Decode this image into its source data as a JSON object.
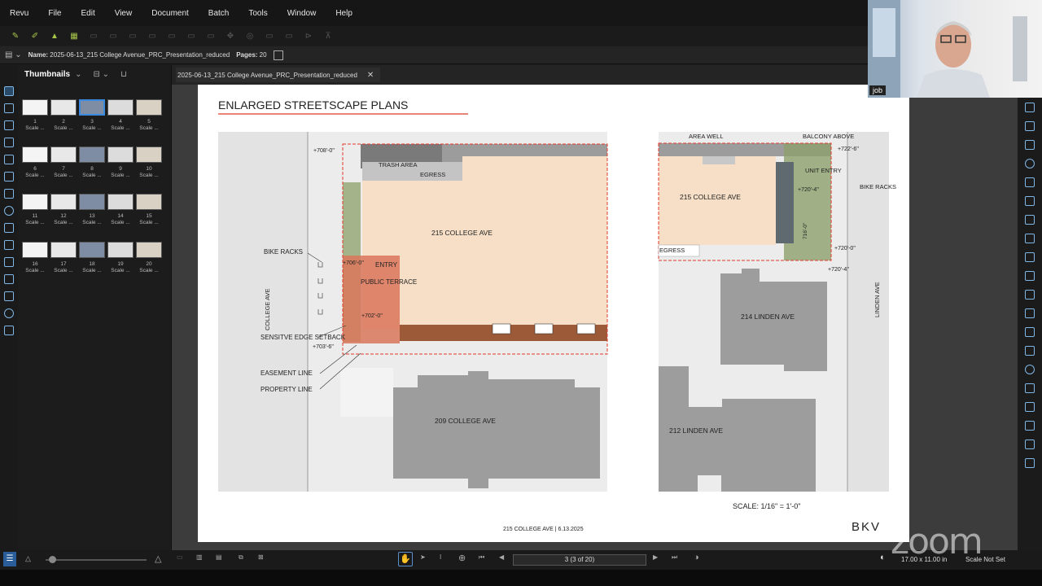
{
  "menu": [
    "Revu",
    "File",
    "Edit",
    "View",
    "Document",
    "Batch",
    "Tools",
    "Window",
    "Help"
  ],
  "file_info": {
    "name_label": "Name:",
    "name_value": "2025-06-13_215 College Avenue_PRC_Presentation_reduced",
    "pages_label": "Pages:",
    "pages_value": "20"
  },
  "thumbnails": {
    "title": "Thumbnails",
    "items": [
      {
        "num": "1",
        "label": "Scale ..."
      },
      {
        "num": "2",
        "label": "Scale ..."
      },
      {
        "num": "3",
        "label": "Scale ..."
      },
      {
        "num": "4",
        "label": "Scale ..."
      },
      {
        "num": "5",
        "label": "Scale ..."
      },
      {
        "num": "6",
        "label": "Scale ..."
      },
      {
        "num": "7",
        "label": "Scale ..."
      },
      {
        "num": "8",
        "label": "Scale ..."
      },
      {
        "num": "9",
        "label": "Scale ..."
      },
      {
        "num": "10",
        "label": "Scale ..."
      },
      {
        "num": "11",
        "label": "Scale ..."
      },
      {
        "num": "12",
        "label": "Scale ..."
      },
      {
        "num": "13",
        "label": "Scale ..."
      },
      {
        "num": "14",
        "label": "Scale ..."
      },
      {
        "num": "15",
        "label": "Scale ..."
      },
      {
        "num": "16",
        "label": "Scale ..."
      },
      {
        "num": "17",
        "label": "Scale ..."
      },
      {
        "num": "18",
        "label": "Scale ..."
      },
      {
        "num": "19",
        "label": "Scale ..."
      },
      {
        "num": "20",
        "label": "Scale ..."
      }
    ],
    "selected": "3"
  },
  "doc_tab": {
    "title": "2025-06-13_215 College Avenue_PRC_Presentation_reduced"
  },
  "sheet": {
    "title": "ENLARGED STREETSCAPE PLANS",
    "scale": "SCALE: 1/16\" = 1'-0\"",
    "footer": "215 COLLEGE AVE  |  6.13.2025",
    "logo": "BKV",
    "left_plan": {
      "building": "215 COLLEGE AVE",
      "neighbor": "209 COLLEGE AVE",
      "street": "COLLEGE AVE",
      "labels": {
        "trash": "TRASH AREA",
        "egress": "EGRESS",
        "entry": "ENTRY",
        "terrace": "PUBLIC TERRACE",
        "bike": "BIKE RACKS",
        "edge": "SENSITVE EDGE SETBACK",
        "easement": "EASEMENT LINE",
        "property": "PROPERTY LINE"
      },
      "elevations": {
        "e1": "+708'-0\"",
        "e2": "+706'-0\"",
        "e3": "+702'-0\"",
        "e4": "+703'-6\""
      }
    },
    "right_plan": {
      "building": "215 COLLEGE AVE",
      "neighbor1": "214 LINDEN AVE",
      "neighbor2": "212 LINDEN AVE",
      "street": "LINDEN AVE",
      "labels": {
        "area_well": "AREA WELL",
        "balcony": "BALCONY ABOVE",
        "unit_entry": "UNIT ENTRY",
        "bike": "BIKE RACKS",
        "egress": "EGRESS"
      },
      "elevations": {
        "e1": "+722'-6\"",
        "e2": "+720'-4\"",
        "e3": "+720'-0\"",
        "e4": "+720'-4\"",
        "e5": "716'-0\""
      }
    }
  },
  "bottom": {
    "page_indicator": "3 (3 of 20)",
    "page_size": "17.00 x 11.00 in",
    "scale_status": "Scale Not Set"
  },
  "webcam": {
    "name": "job"
  },
  "watermark": "zoom"
}
